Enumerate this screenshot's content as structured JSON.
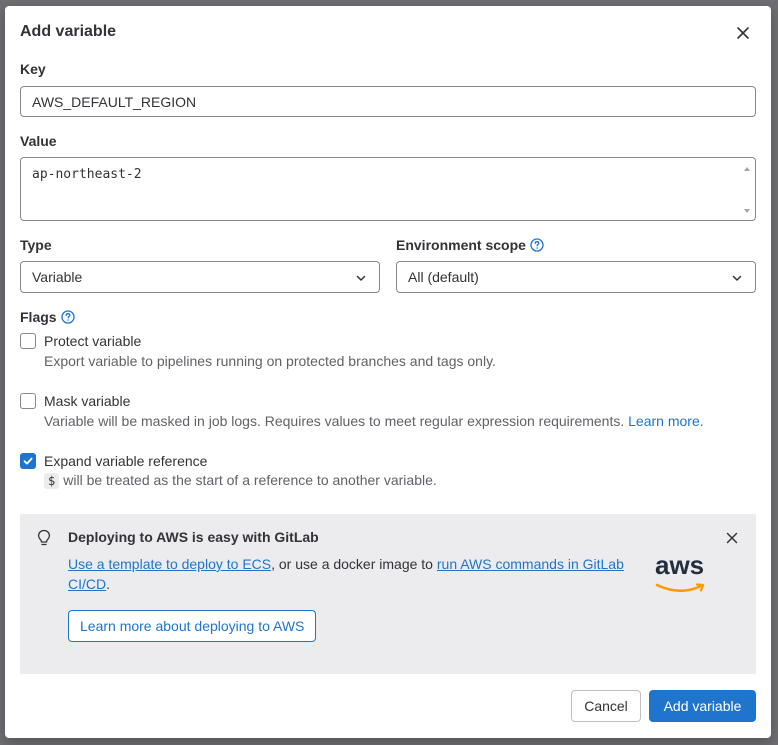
{
  "modal": {
    "title": "Add variable",
    "close_icon": "close-icon"
  },
  "key": {
    "label": "Key",
    "value": "AWS_DEFAULT_REGION"
  },
  "value": {
    "label": "Value",
    "value": "ap-northeast-2"
  },
  "type": {
    "label": "Type",
    "selected": "Variable"
  },
  "environment_scope": {
    "label": "Environment scope",
    "selected": "All (default)"
  },
  "flags": {
    "label": "Flags",
    "protect": {
      "label": "Protect variable",
      "help": "Export variable to pipelines running on protected branches and tags only.",
      "checked": false
    },
    "mask": {
      "label": "Mask variable",
      "help": "Variable will be masked in job logs. Requires values to meet regular expression requirements.",
      "help_link": "Learn more.",
      "checked": false
    },
    "expand": {
      "label": "Expand variable reference",
      "code": "$",
      "help": "will be treated as the start of a reference to another variable.",
      "checked": true
    }
  },
  "alert": {
    "title": "Deploying to AWS is easy with GitLab",
    "link1": "Use a template to deploy to ECS",
    "text1": ", or use a docker image to ",
    "link2": "run AWS commands in GitLab CI/CD",
    "text2": ".",
    "button": "Learn more about deploying to AWS",
    "logo_text": "aws"
  },
  "footer": {
    "cancel": "Cancel",
    "submit": "Add variable"
  },
  "colors": {
    "primary": "#1f75cb",
    "alert_bg": "#ececef",
    "aws_orange": "#ff9900"
  }
}
